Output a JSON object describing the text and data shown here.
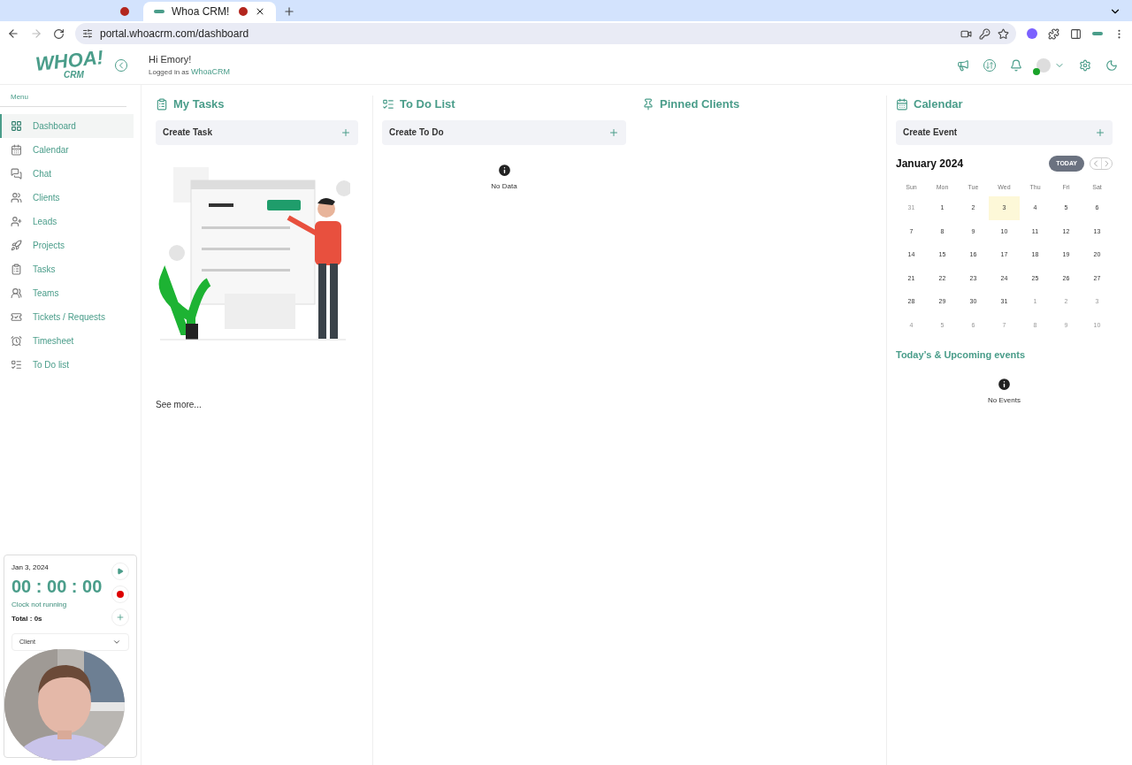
{
  "browser": {
    "tabs": [
      {
        "selected": false
      },
      {
        "title": "Whoa CRM!",
        "selected": true
      }
    ],
    "url": "portal.whoacrm.com/dashboard"
  },
  "header": {
    "greeting": "Hi Emory!",
    "logged_prefix": "Logged in as",
    "logged_user": "WhoaCRM",
    "logo_main": "WHOA!",
    "logo_sub": "CRM"
  },
  "sidebar": {
    "menu_label": "Menu",
    "items": [
      {
        "label": "Dashboard",
        "selected": true
      },
      {
        "label": "Calendar",
        "selected": false
      },
      {
        "label": "Chat",
        "selected": false
      },
      {
        "label": "Clients",
        "selected": false
      },
      {
        "label": "Leads",
        "selected": false
      },
      {
        "label": "Projects",
        "selected": false
      },
      {
        "label": "Tasks",
        "selected": false
      },
      {
        "label": "Teams",
        "selected": false
      },
      {
        "label": "Tickets / Requests",
        "selected": false
      },
      {
        "label": "Timesheet",
        "selected": false
      },
      {
        "label": "To Do list",
        "selected": false
      }
    ]
  },
  "timer": {
    "date": "Jan 3, 2024",
    "time": "00 : 00 : 00",
    "status": "Clock not running",
    "total": "Total : 0s",
    "client_placeholder": "Client"
  },
  "my_tasks": {
    "title": "My Tasks",
    "create": "Create Task",
    "see_more": "See more..."
  },
  "todo": {
    "title": "To Do List",
    "create": "Create To Do",
    "empty": "No Data"
  },
  "pinned": {
    "title": "Pinned Clients"
  },
  "calendar": {
    "title": "Calendar",
    "create": "Create Event",
    "month": "January 2024",
    "today_button": "TODAY",
    "weekdays": [
      "Sun",
      "Mon",
      "Tue",
      "Wed",
      "Thu",
      "Fri",
      "Sat"
    ],
    "days": [
      {
        "label": "31",
        "outside": true,
        "selected": false
      },
      {
        "label": "1",
        "outside": false,
        "selected": false
      },
      {
        "label": "2",
        "outside": false,
        "selected": false
      },
      {
        "label": "3",
        "outside": false,
        "selected": true
      },
      {
        "label": "4",
        "outside": false,
        "selected": false
      },
      {
        "label": "5",
        "outside": false,
        "selected": false
      },
      {
        "label": "6",
        "outside": false,
        "selected": false
      },
      {
        "label": "7",
        "outside": false,
        "selected": false
      },
      {
        "label": "8",
        "outside": false,
        "selected": false
      },
      {
        "label": "9",
        "outside": false,
        "selected": false
      },
      {
        "label": "10",
        "outside": false,
        "selected": false
      },
      {
        "label": "11",
        "outside": false,
        "selected": false
      },
      {
        "label": "12",
        "outside": false,
        "selected": false
      },
      {
        "label": "13",
        "outside": false,
        "selected": false
      },
      {
        "label": "14",
        "outside": false,
        "selected": false
      },
      {
        "label": "15",
        "outside": false,
        "selected": false
      },
      {
        "label": "16",
        "outside": false,
        "selected": false
      },
      {
        "label": "17",
        "outside": false,
        "selected": false
      },
      {
        "label": "18",
        "outside": false,
        "selected": false
      },
      {
        "label": "19",
        "outside": false,
        "selected": false
      },
      {
        "label": "20",
        "outside": false,
        "selected": false
      },
      {
        "label": "21",
        "outside": false,
        "selected": false
      },
      {
        "label": "22",
        "outside": false,
        "selected": false
      },
      {
        "label": "23",
        "outside": false,
        "selected": false
      },
      {
        "label": "24",
        "outside": false,
        "selected": false
      },
      {
        "label": "25",
        "outside": false,
        "selected": false
      },
      {
        "label": "26",
        "outside": false,
        "selected": false
      },
      {
        "label": "27",
        "outside": false,
        "selected": false
      },
      {
        "label": "28",
        "outside": false,
        "selected": false
      },
      {
        "label": "29",
        "outside": false,
        "selected": false
      },
      {
        "label": "30",
        "outside": false,
        "selected": false
      },
      {
        "label": "31",
        "outside": false,
        "selected": false
      },
      {
        "label": "1",
        "outside": true,
        "selected": false
      },
      {
        "label": "2",
        "outside": true,
        "selected": false
      },
      {
        "label": "3",
        "outside": true,
        "selected": false
      },
      {
        "label": "4",
        "outside": true,
        "selected": false
      },
      {
        "label": "5",
        "outside": true,
        "selected": false
      },
      {
        "label": "6",
        "outside": true,
        "selected": false
      },
      {
        "label": "7",
        "outside": true,
        "selected": false
      },
      {
        "label": "8",
        "outside": true,
        "selected": false
      },
      {
        "label": "9",
        "outside": true,
        "selected": false
      },
      {
        "label": "10",
        "outside": true,
        "selected": false
      }
    ],
    "events_title": "Today’s & Upcoming events",
    "events_empty": "No Events"
  }
}
